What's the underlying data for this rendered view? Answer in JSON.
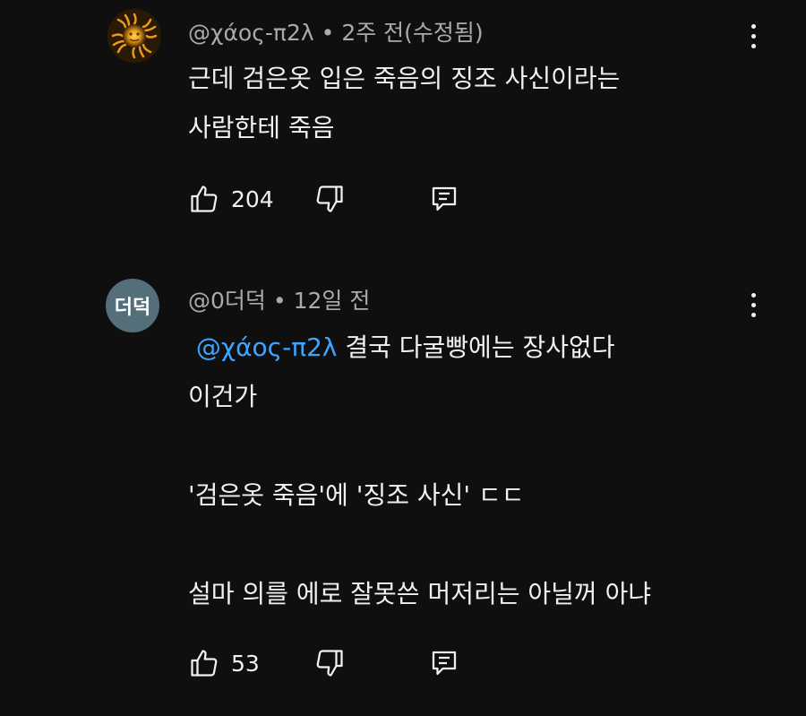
{
  "comments": [
    {
      "author": "@χάος-π2λ",
      "time": "2주 전(수정됨)",
      "avatar_icon": "sun-logo-icon",
      "lines": [
        "근데 검은옷 입은 죽음의 징조 사신이라는",
        "사람한테 죽음"
      ],
      "likes": "204"
    },
    {
      "author": "@0더덕",
      "time": "12일 전",
      "avatar_text": "더덕",
      "avatar_color": "#546e7a",
      "mention": "@χάος-π2λ",
      "first_line_rest": "결국 다굴빵에는 장사없다",
      "lines": [
        "이건가",
        "",
        "'검은옷 죽음'에 '징조 사신' ㄷㄷ",
        "",
        "설마 의를 에로 잘못쓴 머저리는 아닐꺼 아냐"
      ],
      "likes": "53"
    }
  ],
  "separator": "•",
  "colors": {
    "background": "#0f0f0f",
    "mention": "#3ea6ff",
    "meta": "#aaaaaa"
  },
  "icons": [
    "thumbs-up-icon",
    "thumbs-down-icon",
    "reply-icon",
    "more-vert-icon"
  ]
}
